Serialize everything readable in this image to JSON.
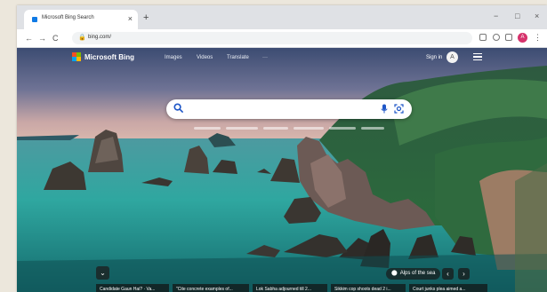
{
  "browser": {
    "tab_title": "Microsoft Bing Search",
    "tab_close": "×",
    "new_tab": "+",
    "url": "bing.com/",
    "profile_initial": "A",
    "window_controls": [
      "−",
      "□",
      "×"
    ],
    "nav": {
      "back": "←",
      "forward": "→",
      "reload": "C"
    }
  },
  "bing": {
    "logo_text": "Microsoft Bing",
    "logo_colors": [
      "#f25022",
      "#7fba00",
      "#00a4ef",
      "#ffb900"
    ],
    "header_links": [
      "Images",
      "Videos",
      "Translate",
      "···"
    ],
    "sign_in": "Sign in",
    "avatar_glyph": "A",
    "search": {
      "value": "",
      "placeholder": ""
    },
    "location_label": "Alps of the sea",
    "news": [
      "Candidate Gaun Hai? · Va...",
      "\"Cite concrete examples of...",
      "Lok Sabha adjourned till 2...",
      "Sikkim cop shoots dead 2 i...",
      "Court junks plea aimed a..."
    ]
  }
}
